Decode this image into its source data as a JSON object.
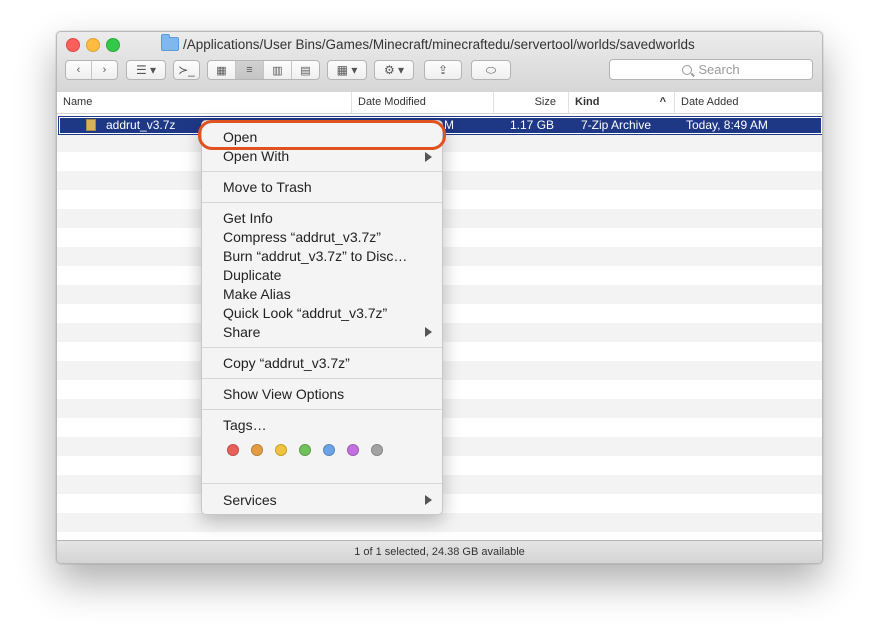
{
  "window": {
    "title_path": "/Applications/User Bins/Games/Minecraft/minecraftedu/servertool/worlds/savedworlds",
    "search_placeholder": "Search",
    "status": "1 of 1 selected, 24.38 GB available"
  },
  "columns": {
    "name": "Name",
    "date_modified": "Date Modified",
    "size": "Size",
    "kind": "Kind",
    "date_added": "Date Added"
  },
  "selected_file": {
    "name": "addrut_v3.7z",
    "date_modified_fragment": "M",
    "size": "1.17 GB",
    "kind": "7-Zip Archive",
    "date_added": "Today, 8:49 AM"
  },
  "menu": {
    "open": "Open",
    "open_with": "Open With",
    "move_to_trash": "Move to Trash",
    "get_info": "Get Info",
    "compress": "Compress “addrut_v3.7z”",
    "burn": "Burn “addrut_v3.7z” to Disc…",
    "duplicate": "Duplicate",
    "make_alias": "Make Alias",
    "quick_look": "Quick Look “addrut_v3.7z”",
    "share": "Share",
    "copy": "Copy “addrut_v3.7z”",
    "show_view_options": "Show View Options",
    "tags": "Tags…",
    "services": "Services"
  },
  "tag_colors": [
    "#e86158",
    "#e49c43",
    "#efc43c",
    "#6fc15a",
    "#6aa3e6",
    "#c36fe0",
    "#a3a3a3"
  ],
  "highlight_color": "#e0521f"
}
